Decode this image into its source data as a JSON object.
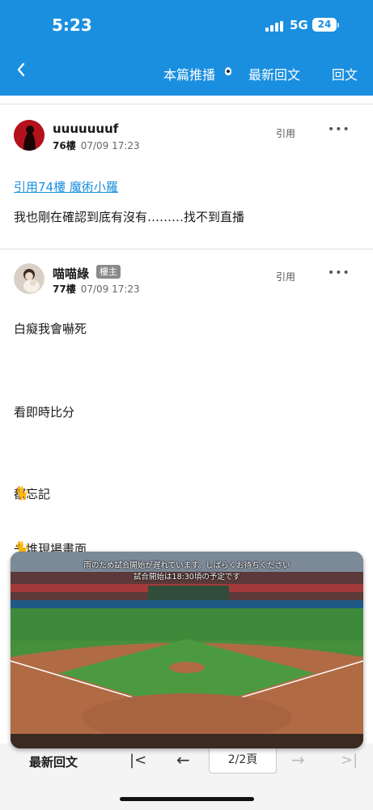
{
  "status_bar": {
    "time": "5:23",
    "network": "5G",
    "battery": "24"
  },
  "header": {
    "back_icon": "chevron-left-icon",
    "push_label": "本篇推播",
    "latest_label": "最新回文",
    "reply_label": "回文"
  },
  "posts": [
    {
      "username": "uuuuuuuf",
      "floor": "76樓",
      "timestamp": "07/09 17:23",
      "quote_label": "引用",
      "more_label": "•••",
      "quote_link": "引用74樓 魔術小羅",
      "body": "我也剛在確認到底有沒有………找不到直播"
    },
    {
      "username": "喵喵綠",
      "badge": "樓主",
      "floor": "77樓",
      "timestamp": "07/09 17:23",
      "quote_label": "引用",
      "more_label": "•••",
      "lines": [
        {
          "icon": "",
          "text": "白癡我會嚇死"
        },
        {
          "icon": "",
          "text": "看即時比分"
        },
        {
          "icon": "🐈",
          "text": "都忘記"
        },
        {
          "icon": "🐈",
          "text": "一堆現場畫面"
        }
      ]
    }
  ],
  "video": {
    "caption_line1": "雨のため試合開始が遅れています。しばらくお待ちください",
    "caption_line2": "試合開始は18:30頃の予定です"
  },
  "bottom_bar": {
    "latest_label": "最新回文",
    "first_icon": "|<",
    "prev_icon": "←",
    "page_label": "2/2頁",
    "next_icon": "→",
    "last_icon": ">|"
  },
  "colors": {
    "header_blue": "#1a8fe0",
    "link_blue": "#1a8fe0",
    "badge_gray": "#8a8a8a"
  }
}
